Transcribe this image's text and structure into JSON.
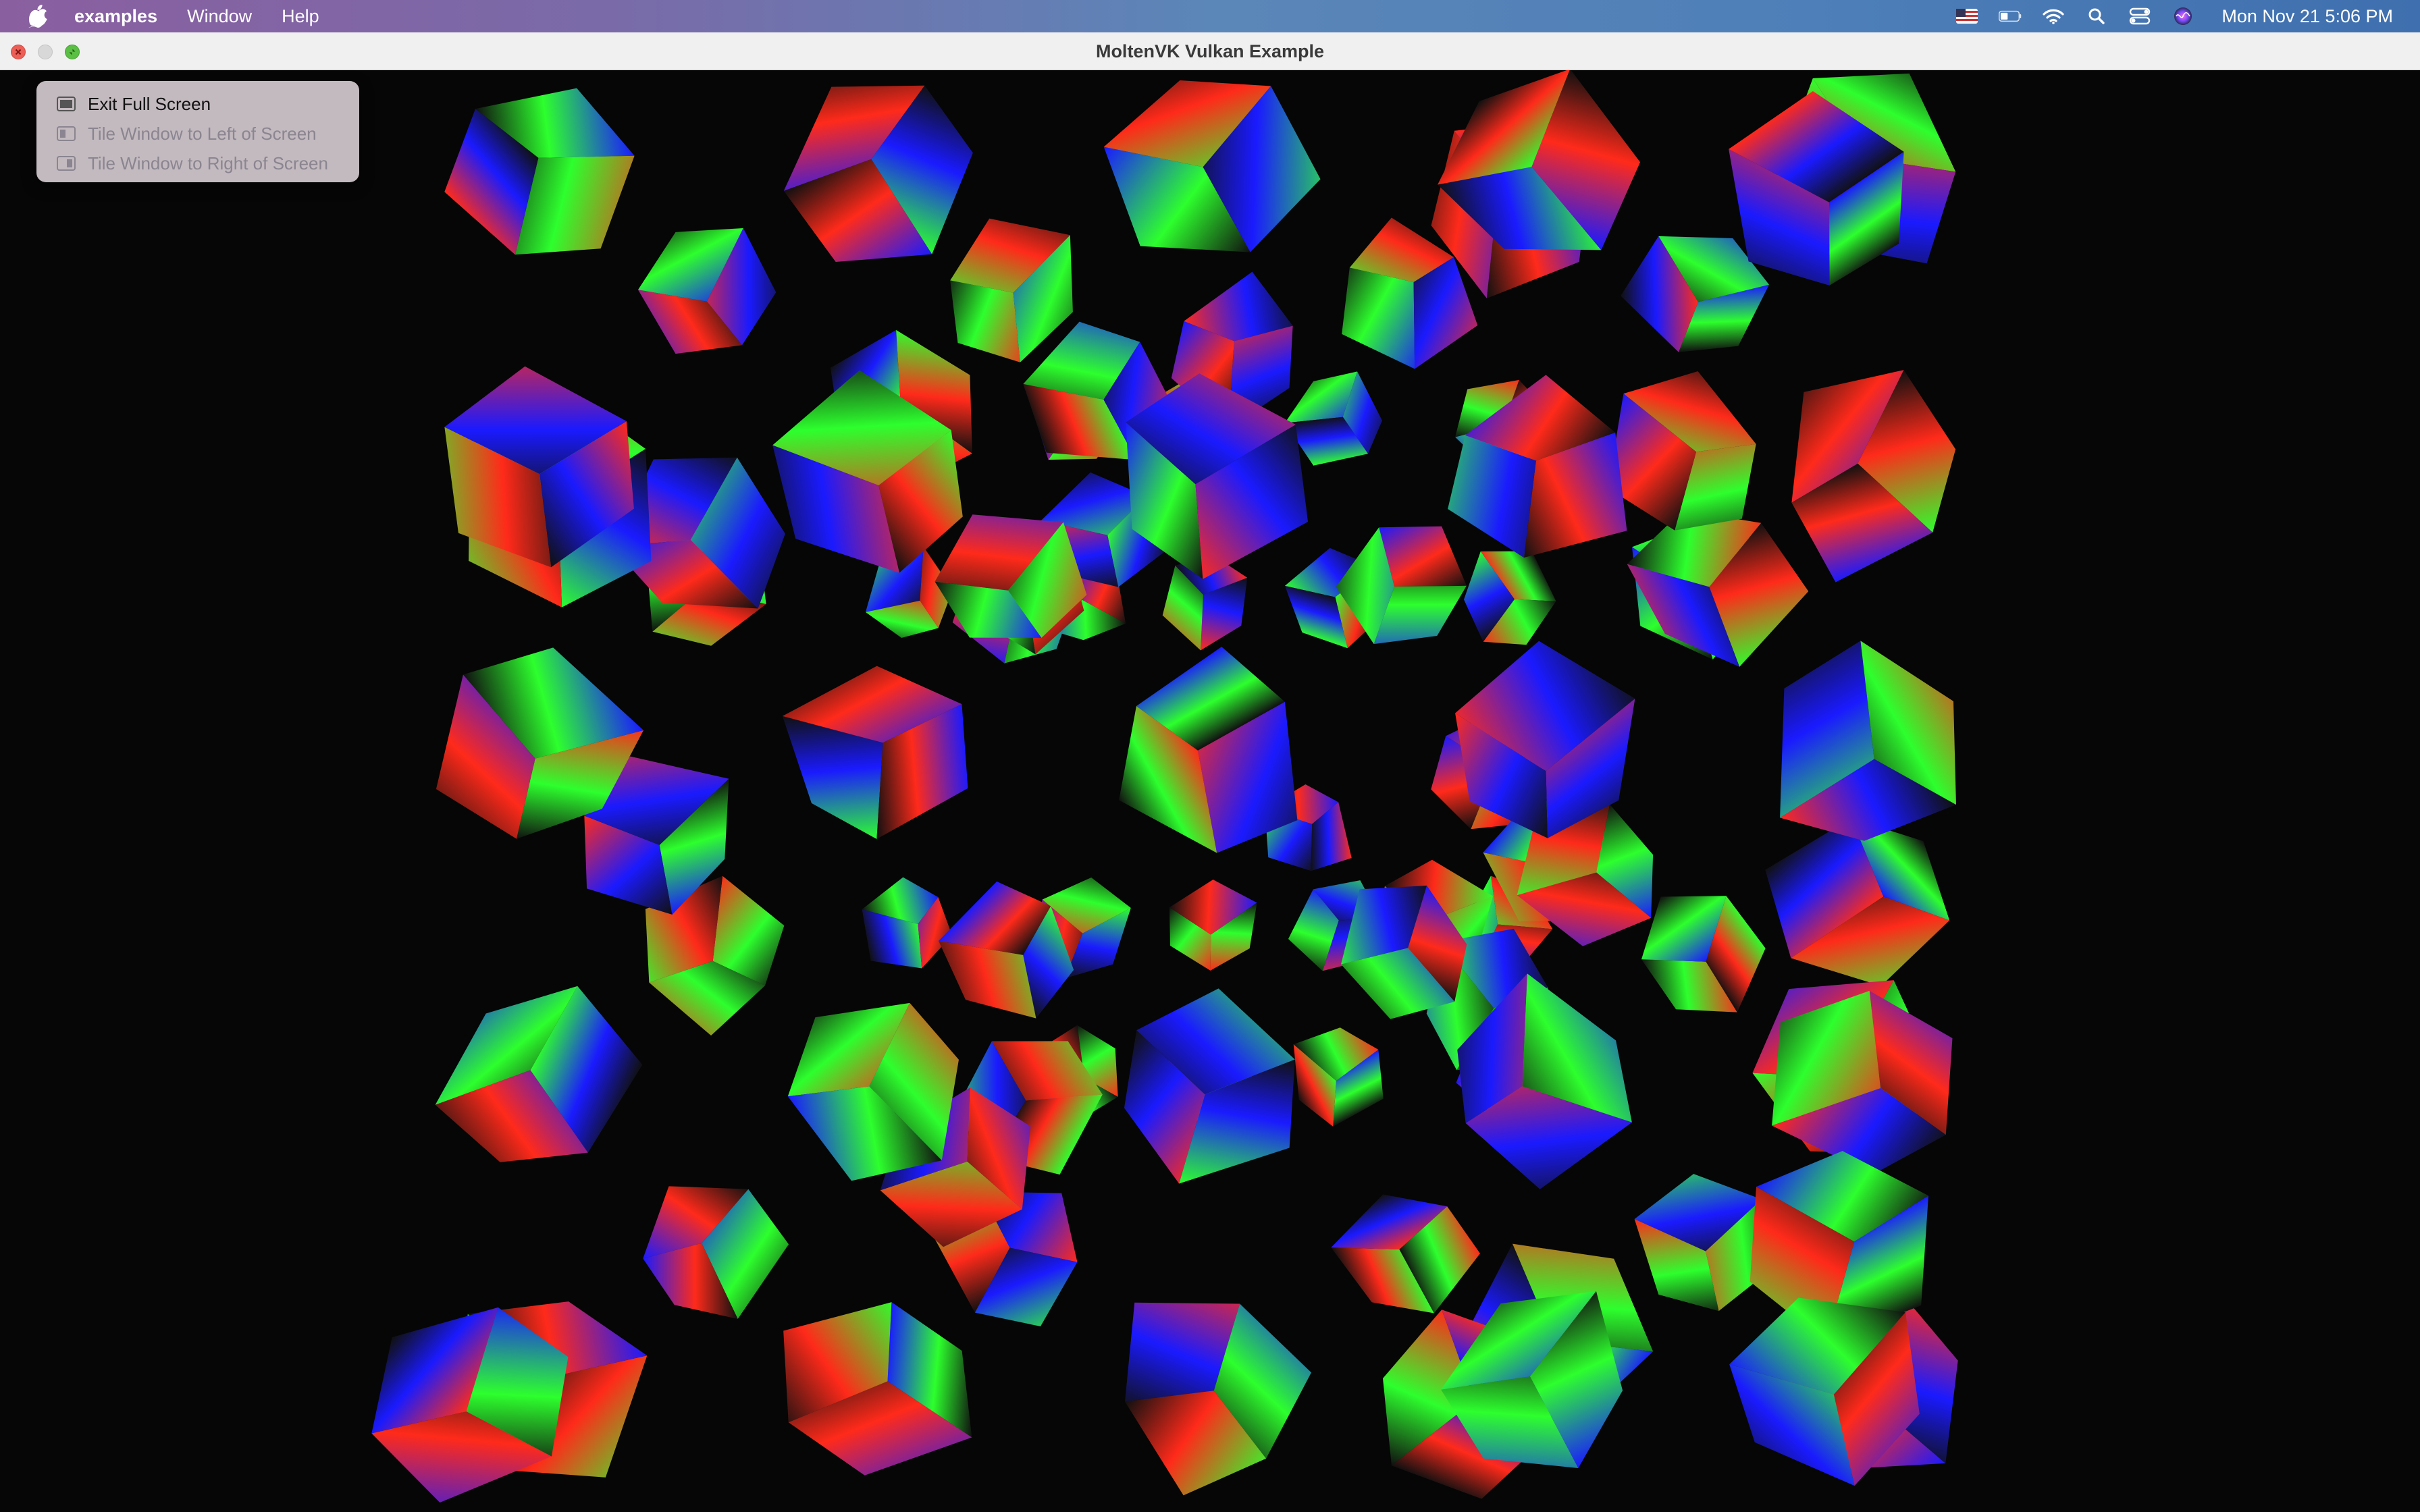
{
  "menubar": {
    "apple_icon": "apple-logo-icon",
    "app_name": "examples",
    "items": [
      "Window",
      "Help"
    ],
    "status_icons": [
      "us-flag-icon",
      "battery-icon",
      "wifi-icon",
      "search-icon",
      "control-center-icon",
      "siri-icon"
    ],
    "clock": "Mon Nov 21  5:06 PM"
  },
  "window": {
    "title": "MoltenVK Vulkan Example",
    "colors": {
      "close": "#ec5f57",
      "minimize": "#d8d8d8",
      "zoom": "#5cbf45"
    }
  },
  "popup_menu": {
    "items": [
      {
        "label": "Exit Full Screen",
        "enabled": true
      },
      {
        "label": "Tile Window to Left of Screen",
        "enabled": false
      },
      {
        "label": "Tile Window to Right of Screen",
        "enabled": false
      }
    ]
  },
  "scene": {
    "background": "#060606",
    "colors": [
      "#ff2a1a",
      "#2dff2d",
      "#1a1aff"
    ],
    "content": "grid of spinning RGB-shaded cubes"
  }
}
